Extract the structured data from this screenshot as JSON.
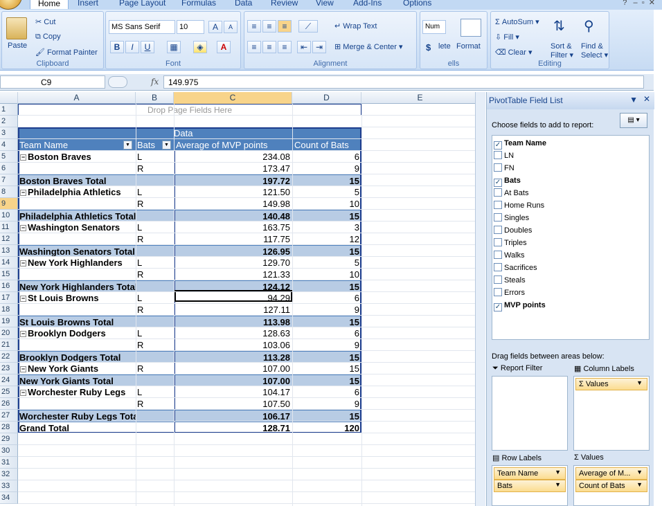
{
  "ribbon_tabs": [
    "Home",
    "Insert",
    "Page Layout",
    "Formulas",
    "Data",
    "Review",
    "View",
    "Add-Ins",
    "Options"
  ],
  "clipboard": {
    "paste": "Paste",
    "cut": "Cut",
    "copy": "Copy",
    "format_painter": "Format Painter",
    "label": "Clipboard"
  },
  "font": {
    "name": "MS Sans Serif",
    "size": "10",
    "bold": "B",
    "italic": "I",
    "underline": "U",
    "color_glyph": "A",
    "grow": "A",
    "shrink": "A",
    "label": "Font"
  },
  "alignment": {
    "wrap": "Wrap Text",
    "merge": "Merge & Center",
    "label": "Alignment"
  },
  "number": {
    "format": "Num",
    "currency": "$"
  },
  "cells": {
    "delete": "lete",
    "format": "Format",
    "label": "ells"
  },
  "editing": {
    "autosum": "AutoSum",
    "fill": "Fill",
    "clear": "Clear",
    "sort": "Sort &",
    "filter": "Filter",
    "find": "Find &",
    "select": "Select",
    "label": "Editing"
  },
  "formula_bar": {
    "cell": "C9",
    "fx": "fx",
    "value": "149.975"
  },
  "columns": [
    "A",
    "B",
    "C",
    "D",
    "E"
  ],
  "rows": [
    "1",
    "2",
    "3",
    "4",
    "5",
    "6",
    "7",
    "8",
    "9",
    "10",
    "11",
    "12",
    "13",
    "14",
    "15",
    "16",
    "17",
    "18",
    "19",
    "20",
    "21",
    "22",
    "23",
    "24",
    "25",
    "26",
    "27",
    "28",
    "29",
    "30",
    "31",
    "32",
    "33",
    "34"
  ],
  "pivot": {
    "drop_page": "Drop Page Fields Here",
    "data_label": "Data",
    "h_team": "Team Name",
    "h_bats": "Bats",
    "h_avg": "Average of MVP points",
    "h_count": "Count of Bats",
    "lines": [
      {
        "a": "Boston Braves",
        "b": "L",
        "c": "234.08",
        "d": "6",
        "kind": "first"
      },
      {
        "a": "",
        "b": "R",
        "c": "173.47",
        "d": "9",
        "kind": "sub"
      },
      {
        "a": "Boston Braves Total",
        "b": "",
        "c": "197.72",
        "d": "15",
        "kind": "total"
      },
      {
        "a": "Philadelphia Athletics",
        "b": "L",
        "c": "121.50",
        "d": "5",
        "kind": "first"
      },
      {
        "a": "",
        "b": "R",
        "c": "149.98",
        "d": "10",
        "kind": "sub"
      },
      {
        "a": "Philadelphia Athletics Total",
        "b": "",
        "c": "140.48",
        "d": "15",
        "kind": "total"
      },
      {
        "a": "Washington Senators",
        "b": "L",
        "c": "163.75",
        "d": "3",
        "kind": "first"
      },
      {
        "a": "",
        "b": "R",
        "c": "117.75",
        "d": "12",
        "kind": "sub"
      },
      {
        "a": "Washington Senators Total",
        "b": "",
        "c": "126.95",
        "d": "15",
        "kind": "total"
      },
      {
        "a": "New York Highlanders",
        "b": "L",
        "c": "129.70",
        "d": "5",
        "kind": "first"
      },
      {
        "a": "",
        "b": "R",
        "c": "121.33",
        "d": "10",
        "kind": "sub"
      },
      {
        "a": "New York Highlanders Total",
        "b": "",
        "c": "124.12",
        "d": "15",
        "kind": "total"
      },
      {
        "a": "St Louis Browns",
        "b": "L",
        "c": "94.29",
        "d": "6",
        "kind": "first"
      },
      {
        "a": "",
        "b": "R",
        "c": "127.11",
        "d": "9",
        "kind": "sub"
      },
      {
        "a": "St Louis Browns Total",
        "b": "",
        "c": "113.98",
        "d": "15",
        "kind": "total"
      },
      {
        "a": "Brooklyn Dodgers",
        "b": "L",
        "c": "128.63",
        "d": "6",
        "kind": "first"
      },
      {
        "a": "",
        "b": "R",
        "c": "103.06",
        "d": "9",
        "kind": "sub"
      },
      {
        "a": "Brooklyn Dodgers Total",
        "b": "",
        "c": "113.28",
        "d": "15",
        "kind": "total"
      },
      {
        "a": "New York Giants",
        "b": "R",
        "c": "107.00",
        "d": "15",
        "kind": "first"
      },
      {
        "a": "New York Giants Total",
        "b": "",
        "c": "107.00",
        "d": "15",
        "kind": "total"
      },
      {
        "a": "Worchester Ruby Legs",
        "b": "L",
        "c": "104.17",
        "d": "6",
        "kind": "first"
      },
      {
        "a": "",
        "b": "R",
        "c": "107.50",
        "d": "9",
        "kind": "sub"
      },
      {
        "a": "Worchester Ruby Legs Total",
        "b": "",
        "c": "106.17",
        "d": "15",
        "kind": "total"
      },
      {
        "a": "Grand Total",
        "b": "",
        "c": "128.71",
        "d": "120",
        "kind": "grand"
      }
    ]
  },
  "field_list": {
    "title": "PivotTable Field List",
    "choose": "Choose fields to add to report:",
    "fields": [
      {
        "name": "Team Name",
        "checked": true
      },
      {
        "name": "LN",
        "checked": false
      },
      {
        "name": "FN",
        "checked": false
      },
      {
        "name": "Bats",
        "checked": true
      },
      {
        "name": "At Bats",
        "checked": false
      },
      {
        "name": "Home Runs",
        "checked": false
      },
      {
        "name": "Singles",
        "checked": false
      },
      {
        "name": "Doubles",
        "checked": false
      },
      {
        "name": "Triples",
        "checked": false
      },
      {
        "name": "Walks",
        "checked": false
      },
      {
        "name": "Sacrifices",
        "checked": false
      },
      {
        "name": "Steals",
        "checked": false
      },
      {
        "name": "Errors",
        "checked": false
      },
      {
        "name": "MVP points",
        "checked": true
      }
    ],
    "drag": "Drag fields between areas below:",
    "report_filter": "Report Filter",
    "column_labels": "Column Labels",
    "row_labels": "Row Labels",
    "values": "Values",
    "col_chip": "Σ Values",
    "row_chips": [
      "Team Name",
      "Bats"
    ],
    "value_chips": [
      "Average of M...",
      "Count of Bats"
    ]
  },
  "colors": {
    "header_blue": "#4f81bd",
    "total_blue": "#b8cce4",
    "selection": "#f8d48a"
  }
}
